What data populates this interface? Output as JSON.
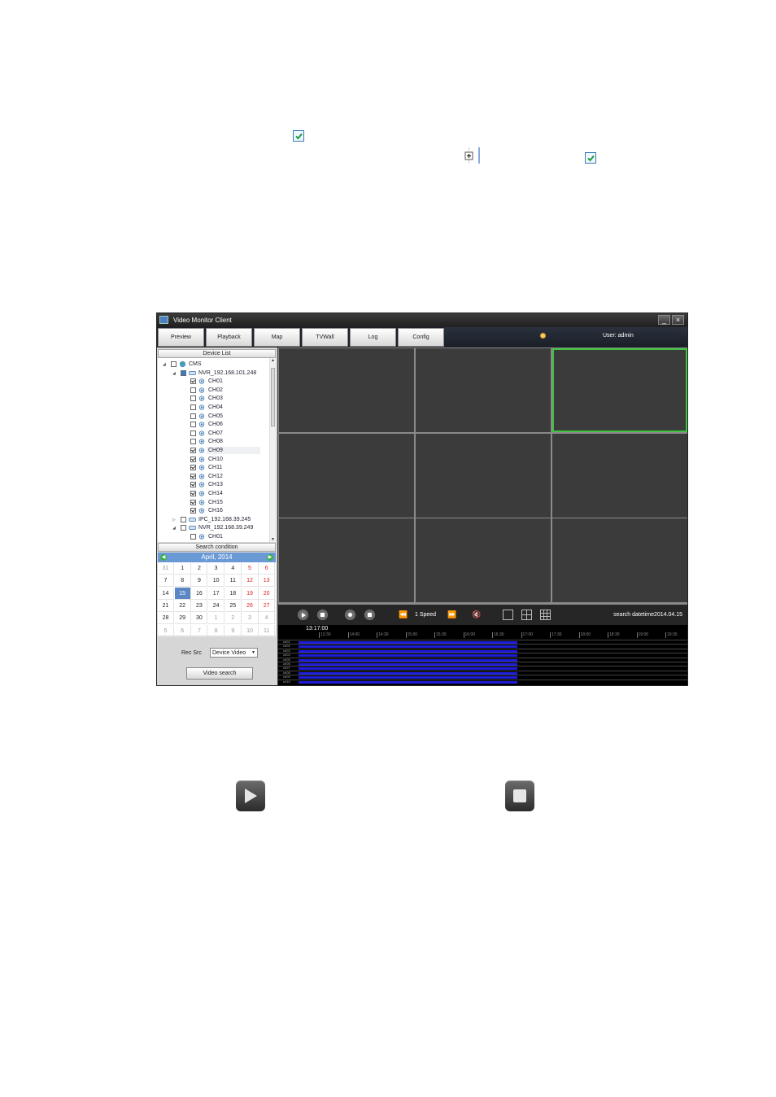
{
  "window": {
    "title": "Video Monitor Client",
    "minimize": "_",
    "close": "×"
  },
  "menu": {
    "tabs": [
      {
        "label": "Preview"
      },
      {
        "label": "Playback"
      },
      {
        "label": "Map"
      },
      {
        "label": "TVWall"
      },
      {
        "label": "Log"
      },
      {
        "label": "Config"
      }
    ],
    "user": "User: admin"
  },
  "device_list": {
    "header": "Device List",
    "root": "CMS",
    "nvr1": "NVR_192.168.101.248",
    "channels": [
      "CH01",
      "CH02",
      "CH03",
      "CH04",
      "CH05",
      "CH06",
      "CH07",
      "CH08",
      "CH09",
      "CH10",
      "CH11",
      "CH12",
      "CH13",
      "CH14",
      "CH15",
      "CH16"
    ],
    "checked": [
      true,
      false,
      false,
      false,
      false,
      false,
      false,
      false,
      true,
      true,
      true,
      true,
      true,
      true,
      true,
      true
    ],
    "ipc": "IPC_192.168.39.245",
    "nvr2": "NVR_192.168.39.249",
    "nvr2_ch": "CH01"
  },
  "search": {
    "header": "Search condition",
    "month": "April,  2014",
    "calendar": [
      [
        "31",
        "1",
        "2",
        "3",
        "4",
        "5",
        "6"
      ],
      [
        "7",
        "8",
        "9",
        "10",
        "11",
        "12",
        "13"
      ],
      [
        "14",
        "15",
        "16",
        "17",
        "18",
        "19",
        "20"
      ],
      [
        "21",
        "22",
        "23",
        "24",
        "25",
        "26",
        "27"
      ],
      [
        "28",
        "29",
        "30",
        "1",
        "2",
        "3",
        "4"
      ],
      [
        "5",
        "6",
        "7",
        "8",
        "9",
        "10",
        "11"
      ]
    ],
    "selected_day": "15",
    "rec_src_label": "Rec Src",
    "rec_src_value": "Device Video",
    "button": "Video search"
  },
  "controls": {
    "speed": "1 Speed",
    "search_datetime": "search datetime2014.04.15"
  },
  "timeline": {
    "current_time": "13:17:00",
    "ticks": [
      "13:30",
      "14:00",
      "14:30",
      "15:00",
      "15:30",
      "16:00",
      "16:30",
      "17:00",
      "17:30",
      "18:00",
      "18:30",
      "19:00",
      "19:30"
    ],
    "rows": [
      "ch01",
      "ch02",
      "ch03",
      "ch04",
      "ch05",
      "ch06",
      "ch07",
      "ch08",
      "ch09",
      "ch10"
    ]
  },
  "colors": {
    "active_cell": "#3fc43f",
    "record_bar": "#1d1ddb",
    "calendar_header": "#6a9ad6",
    "weekend": "#e02020"
  }
}
